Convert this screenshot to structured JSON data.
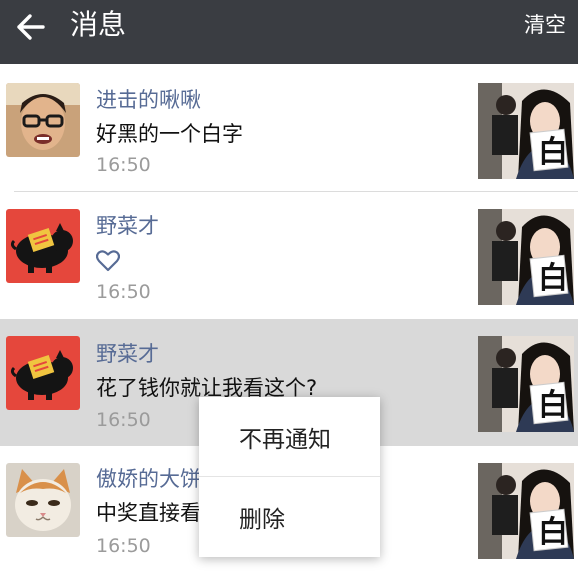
{
  "header": {
    "back_icon": "arrow-left-icon",
    "title": "消息",
    "clear_label": "清空",
    "background": "#3a3d42"
  },
  "messages": [
    {
      "name": "进击的啾啾",
      "text": "好黑的一个白字",
      "time": "16:50",
      "avatar_icon": "avatar-glasses-man",
      "thumbnail": "photo-girl-holding-白-card"
    },
    {
      "name": "野菜才",
      "text": "",
      "reaction_icon": "heart-outline-icon",
      "time": "16:50",
      "avatar_icon": "avatar-black-pig",
      "thumbnail": "photo-girl-holding-白-card"
    },
    {
      "name": "野菜才",
      "text": "花了钱你就让我看这个?",
      "time": "16:50",
      "avatar_icon": "avatar-black-pig",
      "thumbnail": "photo-girl-holding-白-card"
    },
    {
      "name": "傲娇的大饼",
      "text": "中奖直接看",
      "time": "16:50",
      "avatar_icon": "avatar-cat",
      "thumbnail": "photo-girl-holding-白-card"
    }
  ],
  "thumbnail_card_char": "白",
  "context_menu": {
    "items": [
      "不再通知",
      "删除"
    ]
  },
  "colors": {
    "name_link": "#576b95",
    "pressed_row": "#d9d9d9",
    "time_gray": "#9b9b9b"
  }
}
